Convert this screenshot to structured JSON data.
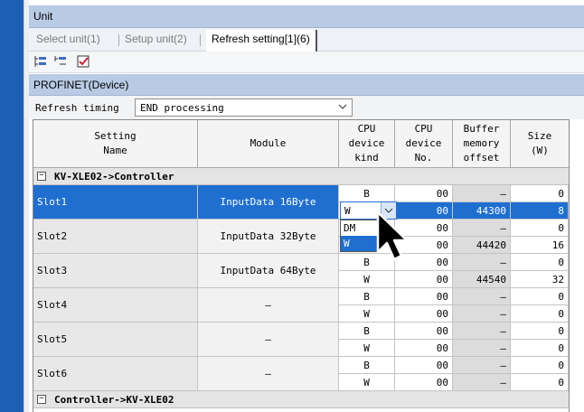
{
  "unit_header": "Unit",
  "tabs": [
    {
      "label": "Select unit(1)",
      "active": false
    },
    {
      "label": "Setup unit(2)",
      "active": false
    },
    {
      "label": "Refresh setting[1](6)",
      "active": true
    }
  ],
  "toolbar": {
    "icons": [
      "expand-tree-icon",
      "collapse-tree-icon",
      "checklist-icon"
    ]
  },
  "section_header": "PROFINET(Device)",
  "refresh": {
    "label": "Refresh timing",
    "value": "END processing"
  },
  "columns": {
    "setting_name": "Setting\nName",
    "module": "Module",
    "cpu_device_kind": "CPU\ndevice\nkind",
    "cpu_device_no": "CPU\ndevice\nNo.",
    "buffer_memory_offset": "Buffer\nmemory\noffset",
    "size": "Size\n(W)"
  },
  "groups": [
    {
      "label": "KV-XLE02->Controller",
      "collapse_symbol": "−"
    },
    {
      "label": "Controller->KV-XLE02",
      "collapse_symbol": "−"
    }
  ],
  "slots": [
    {
      "name": "Slot1",
      "module": "InputData 16Byte",
      "rows": [
        {
          "kind": "B",
          "no": "00",
          "offset": "–",
          "size": "0"
        },
        {
          "kind": "W",
          "no": "00",
          "offset": "44300",
          "size": "8"
        }
      ]
    },
    {
      "name": "Slot2",
      "module": "InputData 32Byte",
      "rows": [
        {
          "kind": "B",
          "no": "00",
          "offset": "–",
          "size": "0"
        },
        {
          "kind": "W",
          "no": "00",
          "offset": "44420",
          "size": "16"
        }
      ]
    },
    {
      "name": "Slot3",
      "module": "InputData 64Byte",
      "rows": [
        {
          "kind": "B",
          "no": "00",
          "offset": "–",
          "size": "0"
        },
        {
          "kind": "W",
          "no": "00",
          "offset": "44540",
          "size": "32"
        }
      ]
    },
    {
      "name": "Slot4",
      "module": "–",
      "rows": [
        {
          "kind": "B",
          "no": "00",
          "offset": "–",
          "size": "0"
        },
        {
          "kind": "W",
          "no": "00",
          "offset": "–",
          "size": "0"
        }
      ]
    },
    {
      "name": "Slot5",
      "module": "–",
      "rows": [
        {
          "kind": "B",
          "no": "00",
          "offset": "–",
          "size": "0"
        },
        {
          "kind": "W",
          "no": "00",
          "offset": "–",
          "size": "0"
        }
      ]
    },
    {
      "name": "Slot6",
      "module": "–",
      "rows": [
        {
          "kind": "B",
          "no": "00",
          "offset": "–",
          "size": "0"
        },
        {
          "kind": "W",
          "no": "00",
          "offset": "–",
          "size": "0"
        }
      ]
    }
  ],
  "device_kind_dropdown": {
    "current": "W",
    "options": [
      "DM",
      "W"
    ],
    "highlighted": "W"
  },
  "colors": {
    "selection": "#1f6fd1",
    "header_band": "#b9cbe4",
    "side_strip": "#1e5fb6"
  }
}
